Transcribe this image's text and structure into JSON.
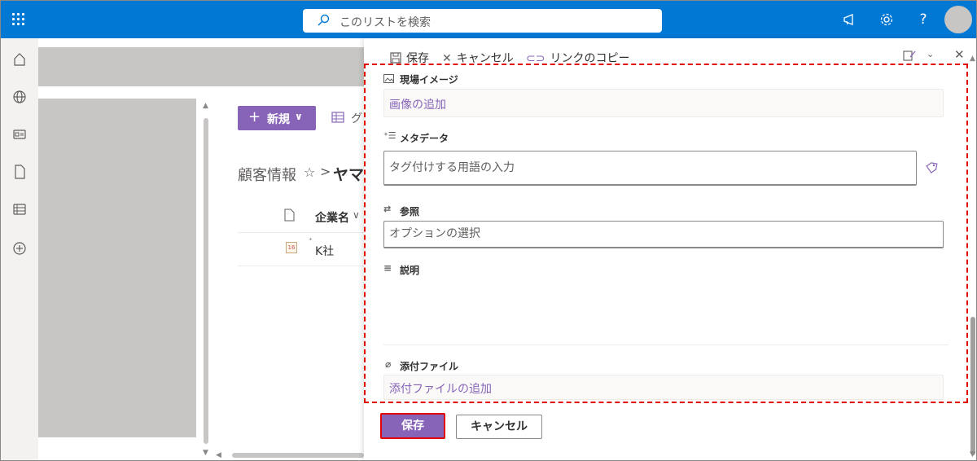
{
  "topbar": {
    "search_placeholder": "このリストを検索",
    "accent": "#0078d4",
    "icons": [
      "waffle-icon",
      "megaphone-icon",
      "gear-icon",
      "help-icon",
      "avatar"
    ],
    "help_glyph": "?"
  },
  "rail": {
    "icons": [
      "home-icon",
      "globe-icon",
      "news-icon",
      "file-icon",
      "list-icon",
      "add-icon"
    ]
  },
  "list": {
    "new_label": "新規",
    "grid_label": "グ",
    "breadcrumb_parent": "顧客情報",
    "breadcrumb_current": "ヤマ",
    "breadcrumb_separator": ">",
    "star_glyph": "☆",
    "column_header": "企業名",
    "rows": [
      {
        "name": "K社",
        "icon_text": "16"
      }
    ]
  },
  "panel": {
    "commands": {
      "save": "保存",
      "cancel": "キャンセル",
      "copy_link": "リンクのコピー"
    },
    "fields": {
      "site_image": {
        "label": "現場イメージ",
        "action": "画像の追加"
      },
      "metadata": {
        "label": "メタデータ",
        "placeholder": "タグ付けする用語の入力"
      },
      "lookup": {
        "label": "参照",
        "placeholder": "オプションの選択"
      },
      "description": {
        "label": "説明",
        "value": ""
      },
      "attachments": {
        "label": "添付ファイル",
        "action": "添付ファイルの追加"
      }
    },
    "footer": {
      "save": "保存",
      "cancel": "キャンセル"
    },
    "accent": "#8764b8",
    "highlight_color": "#e00000"
  }
}
